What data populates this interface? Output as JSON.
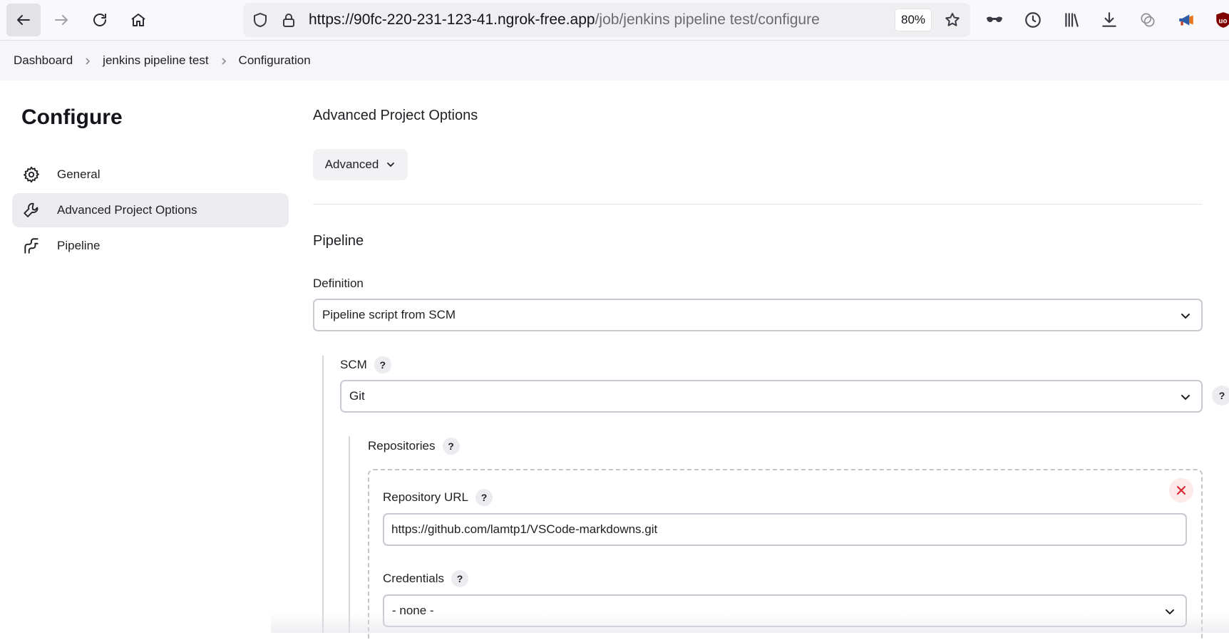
{
  "browser": {
    "url_host": "https://90fc-220-231-123-41.ngrok-free.app",
    "url_path": "/job/jenkins pipeline test/configure",
    "zoom": "80%",
    "icons": [
      "back-icon",
      "forward-icon",
      "reload-icon",
      "home-icon",
      "shield-icon",
      "lock-icon",
      "star-icon",
      "private-mask-icon",
      "history-icon",
      "library-icon",
      "download-icon",
      "extension-icon",
      "megaphone-icon",
      "ublock-icon"
    ]
  },
  "breadcrumb": {
    "items": [
      "Dashboard",
      "jenkins pipeline test",
      "Configuration"
    ]
  },
  "sidebar": {
    "title": "Configure",
    "items": [
      {
        "label": "General",
        "icon": "gear-icon"
      },
      {
        "label": "Advanced Project Options",
        "icon": "wrench-icon"
      },
      {
        "label": "Pipeline",
        "icon": "pipeline-icon"
      }
    ],
    "selected_index": 1
  },
  "main": {
    "advanced_section_title": "Advanced Project Options",
    "advanced_button": "Advanced",
    "pipeline_section_title": "Pipeline",
    "definition": {
      "label": "Definition",
      "value": "Pipeline script from SCM"
    },
    "scm": {
      "label": "SCM",
      "help": "?",
      "value": "Git"
    },
    "repositories": {
      "label": "Repositories",
      "help": "?",
      "repository_url": {
        "label": "Repository URL",
        "help": "?",
        "value": "https://github.com/lamtp1/VSCode-markdowns.git"
      },
      "credentials": {
        "label": "Credentials",
        "help": "?",
        "value": "- none -"
      }
    },
    "edge_help": "?"
  },
  "colors": {
    "remove_accent": "#d3242f",
    "selected_bg": "#ececf0"
  }
}
